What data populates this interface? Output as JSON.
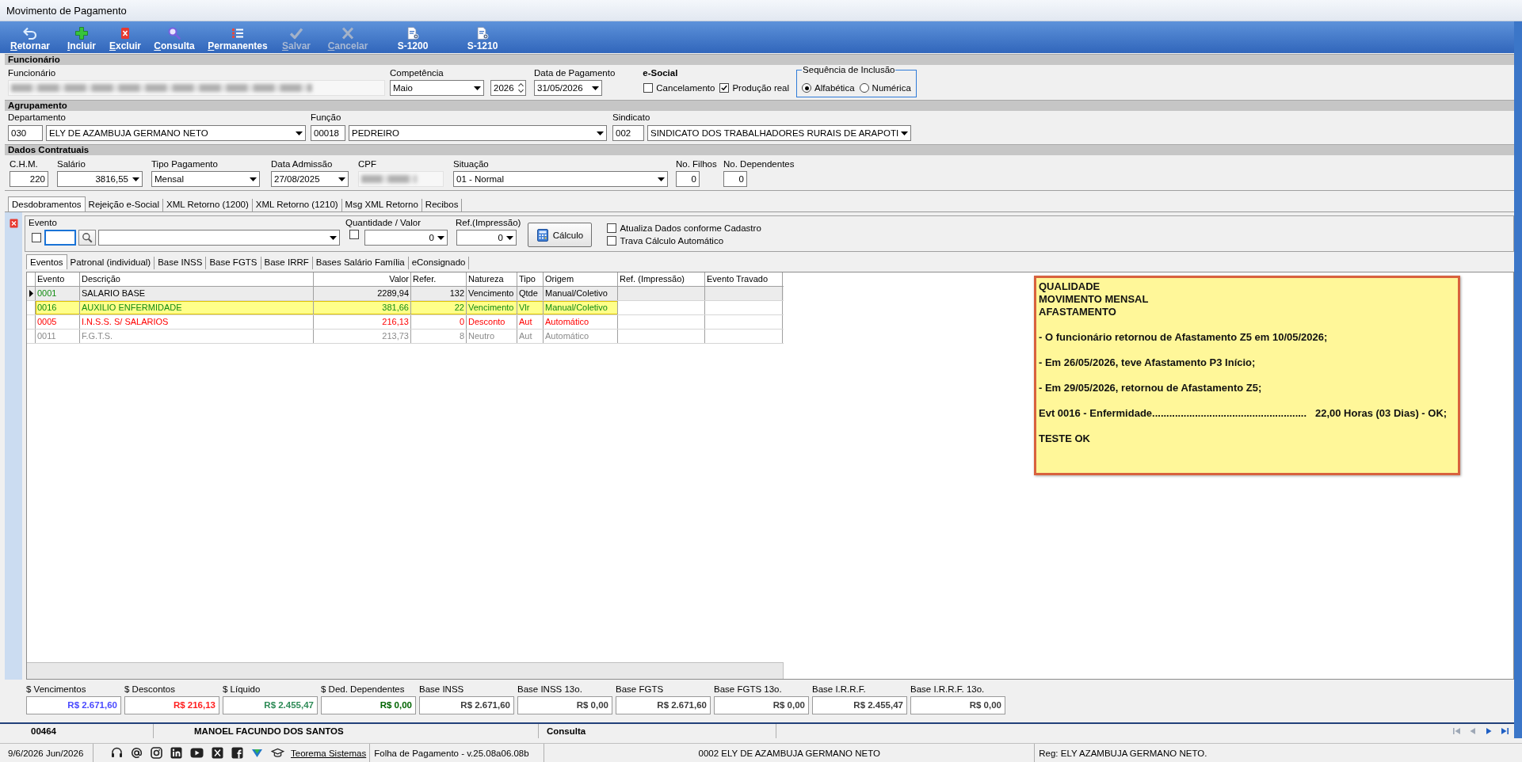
{
  "window": {
    "title": "Movimento de Pagamento"
  },
  "toolbar": [
    {
      "label": "Retornar",
      "kind": "back",
      "disabled": false,
      "accelerator": true
    },
    {
      "label": "Incluir",
      "kind": "add",
      "disabled": false,
      "accelerator": true
    },
    {
      "label": "Excluir",
      "kind": "delete",
      "disabled": false,
      "accelerator": true
    },
    {
      "label": "Consulta",
      "kind": "search",
      "disabled": false,
      "accelerator": true
    },
    {
      "label": "Permanentes",
      "kind": "list",
      "disabled": false,
      "accelerator": true
    },
    {
      "label": "Salvar",
      "kind": "save",
      "disabled": true,
      "accelerator": true
    },
    {
      "label": "Cancelar",
      "kind": "cancel",
      "disabled": true,
      "accelerator": true
    },
    {
      "label": "S-1200",
      "kind": "report",
      "disabled": false,
      "accelerator": false
    },
    {
      "label": "S-1210",
      "kind": "report",
      "disabled": false,
      "accelerator": false
    }
  ],
  "funcionario": {
    "title": "Funcionário",
    "employee": {
      "label": "Funcionário",
      "blurred": true
    },
    "competencia": {
      "label": "Competência",
      "month": "Maio",
      "year": "2026"
    },
    "data_pagamento": {
      "label": "Data de Pagamento",
      "value": "31/05/2026"
    },
    "esocial": {
      "label": "e-Social",
      "options": [
        {
          "label": "Cancelamento",
          "checked": false
        },
        {
          "label": "Produção real",
          "checked": true
        }
      ]
    },
    "sequencia": {
      "title": "Sequência de Inclusão",
      "options": [
        {
          "label": "Alfabética",
          "selected": true
        },
        {
          "label": "Numérica",
          "selected": false
        }
      ]
    }
  },
  "agrupamento": {
    "title": "Agrupamento",
    "fields": [
      {
        "label": "Departamento",
        "code": "030",
        "value": "ELY DE AZAMBUJA GERMANO NETO"
      },
      {
        "label": "Função",
        "code": "00018",
        "value": "PEDREIRO"
      },
      {
        "label": "Sindicato",
        "code": "002",
        "value": "SINDICATO DOS TRABALHADORES RURAIS DE ARAPOTI"
      }
    ]
  },
  "dados_contratuais": {
    "title": "Dados Contratuais",
    "fields": [
      {
        "label": "C.H.M.",
        "value": "220",
        "kind": "number"
      },
      {
        "label": "Salário",
        "value": "3816,55",
        "kind": "number_dropdown"
      },
      {
        "label": "Tipo Pagamento",
        "value": "Mensal",
        "kind": "dropdown"
      },
      {
        "label": "Data Admissão",
        "value": "27/08/2025",
        "kind": "dropdown"
      },
      {
        "label": "CPF",
        "kind": "blurred"
      },
      {
        "label": "Situação",
        "value": "01 - Normal",
        "kind": "dropdown"
      },
      {
        "label": "No. Filhos",
        "value": "0",
        "kind": "number"
      },
      {
        "label": "No. Dependentes",
        "value": "0",
        "kind": "number"
      }
    ]
  },
  "tabs": [
    {
      "label": "Desdobramentos",
      "selected": true
    },
    {
      "label": "Rejeição e-Social",
      "selected": false
    },
    {
      "label": "XML Retorno (1200)",
      "selected": false
    },
    {
      "label": "XML Retorno (1210)",
      "selected": false
    },
    {
      "label": "Msg XML Retorno",
      "selected": false
    },
    {
      "label": "Recibos",
      "selected": false
    }
  ],
  "evento_panel": {
    "evento": {
      "label": "Evento",
      "checked": false,
      "focused": true
    },
    "quantidade": {
      "label": "Quantidade / Valor",
      "checked": false,
      "value": "0"
    },
    "ref_impressao": {
      "label": "Ref.(Impressão)",
      "value": "0"
    },
    "calculo_button": "Cálculo",
    "options": [
      {
        "label": "Atualiza Dados conforme Cadastro",
        "checked": false
      },
      {
        "label": "Trava Cálculo Automático",
        "checked": false
      }
    ]
  },
  "sub_tabs": [
    {
      "label": "Eventos",
      "selected": true
    },
    {
      "label": "Patronal (individual)",
      "selected": false
    },
    {
      "label": "Base INSS",
      "selected": false
    },
    {
      "label": "Base FGTS",
      "selected": false
    },
    {
      "label": "Base IRRF",
      "selected": false
    },
    {
      "label": "Bases Salário Família",
      "selected": false
    },
    {
      "label": "eConsignado",
      "selected": false
    }
  ],
  "table": {
    "columns": [
      "Evento",
      "Descrição",
      "Valor",
      "Refer.",
      "Natureza",
      "Tipo",
      "Origem",
      "Ref. (Impressão)",
      "Evento Travado"
    ],
    "rows": [
      {
        "kind": "base",
        "current": true,
        "highlighted": false,
        "cells": [
          "0001",
          "SALARIO BASE",
          "2289,94",
          "132",
          "Vencimento",
          "Qtde",
          "Manual/Coletivo"
        ]
      },
      {
        "kind": "lancado",
        "current": false,
        "highlighted": true,
        "cells": [
          "0016",
          "AUXILIO ENFERMIDADE",
          "381,66",
          "22",
          "Vencimento",
          "Vlr",
          "Manual/Coletivo"
        ]
      },
      {
        "kind": "desconto",
        "current": false,
        "highlighted": false,
        "cells": [
          "0005",
          "I.N.S.S. S/ SALARIOS",
          "216,13",
          "0",
          "Desconto",
          "Aut",
          "Automático"
        ]
      },
      {
        "kind": "neutro",
        "current": false,
        "highlighted": false,
        "cells": [
          "0011",
          "F.G.T.S.",
          "213,73",
          "8",
          "Neutro",
          "Aut",
          "Automático"
        ]
      }
    ]
  },
  "note": {
    "paragraphs": [
      [
        "QUALIDADE",
        "MOVIMENTO MENSAL",
        "AFASTAMENTO"
      ],
      [
        "- O funcionário retornou de Afastamento Z5 em 10/05/2026;"
      ],
      [
        "- Em 26/05/2026, teve Afastamento P3 Início;"
      ],
      [
        "- Em 29/05/2026, retornou de Afastamento Z5;"
      ],
      [
        "Evt 0016 - Enfermidade......................................................   22,00 Horas (03 Dias) - OK;"
      ],
      [
        "TESTE OK"
      ]
    ]
  },
  "totals": [
    {
      "label": "$ Vencimentos",
      "value": "R$ 2.671,60",
      "color": "#4a4aff"
    },
    {
      "label": "$ Descontos",
      "value": "R$ 216,13",
      "color": "#ff2020"
    },
    {
      "label": "$ Líquido",
      "value": "R$ 2.455,47",
      "color": "#2e8b57"
    },
    {
      "label": "$ Ded. Dependentes",
      "value": "R$ 0,00",
      "color": "#006400"
    },
    {
      "label": "Base INSS",
      "value": "R$ 2.671,60",
      "color": "#3c3c3c"
    },
    {
      "label": "Base INSS 13o.",
      "value": "R$ 0,00",
      "color": "#3c3c3c"
    },
    {
      "label": "Base FGTS",
      "value": "R$ 2.671,60",
      "color": "#3c3c3c"
    },
    {
      "label": "Base FGTS 13o.",
      "value": "R$ 0,00",
      "color": "#3c3c3c"
    },
    {
      "label": "Base I.R.R.F.",
      "value": "R$ 2.455,47",
      "color": "#3c3c3c"
    },
    {
      "label": "Base I.R.R.F. 13o.",
      "value": "R$ 0,00",
      "color": "#3c3c3c"
    }
  ],
  "status_bar": {
    "code": "00464",
    "name": "MANOEL FACUNDO DOS SANTOS",
    "mode": "Consulta",
    "nav": [
      {
        "kind": "first",
        "disabled": true
      },
      {
        "kind": "prev",
        "disabled": true
      },
      {
        "kind": "next",
        "disabled": false
      },
      {
        "kind": "last",
        "disabled": false
      }
    ]
  },
  "footer": {
    "date": "9/6/2026 Jun/2026",
    "link": "Teorema Sistemas",
    "version": "Folha de Pagamento - v.25.08a06.08b",
    "company": "0002 ELY DE AZAMBUJA GERMANO NETO",
    "registry": "Reg: ELY AZAMBUJA GERMANO NETO."
  }
}
